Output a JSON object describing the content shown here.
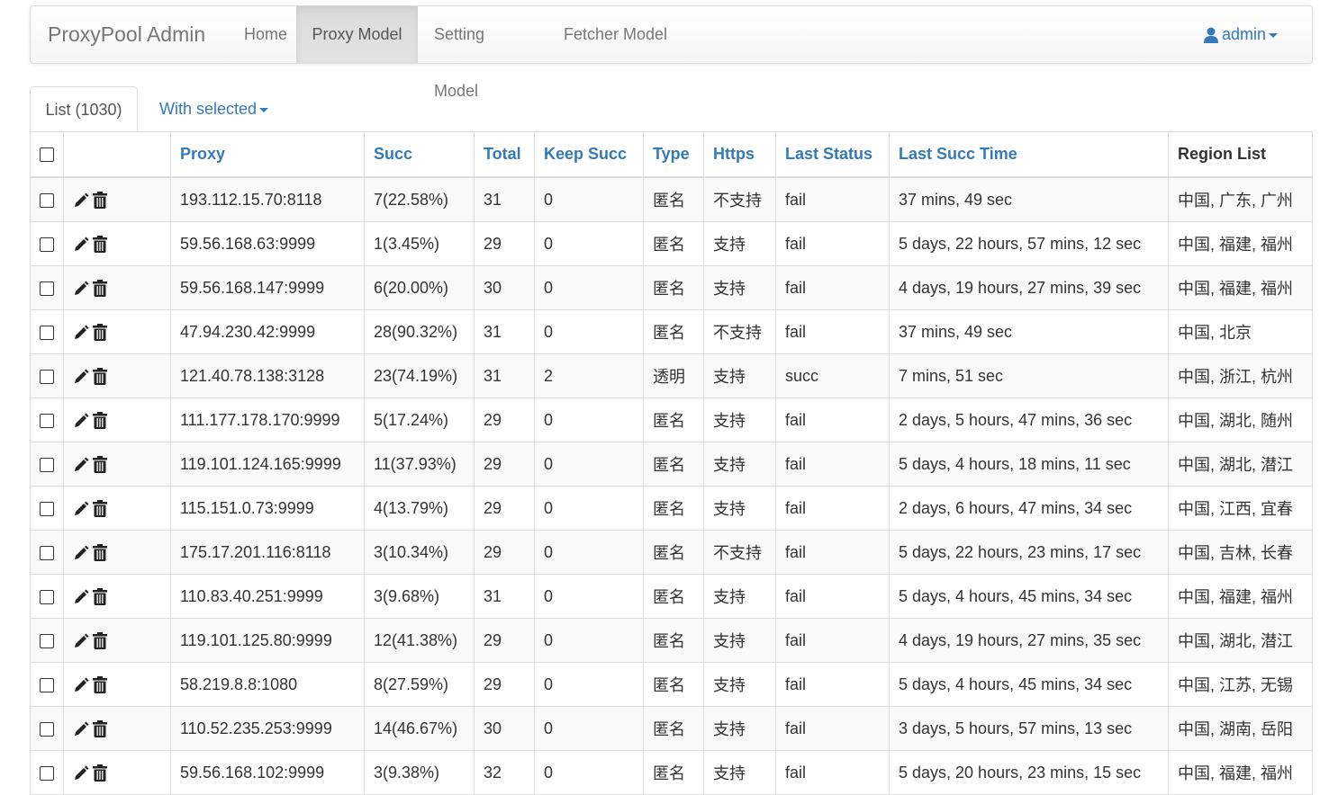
{
  "navbar": {
    "brand": "ProxyPool Admin",
    "links": [
      "Home",
      "Proxy Model",
      "Setting Model",
      "Fetcher Model"
    ],
    "active": "Proxy Model",
    "user": "admin"
  },
  "tabs": {
    "list_label": "List (1030)",
    "with_selected_label": "With selected"
  },
  "table": {
    "headers": [
      "Proxy",
      "Succ",
      "Total",
      "Keep Succ",
      "Type",
      "Https",
      "Last Status",
      "Last Succ Time",
      "Region List"
    ],
    "rows": [
      [
        "193.112.15.70:8118",
        "7(22.58%)",
        "31",
        "0",
        "匿名",
        "不支持",
        "fail",
        "37 mins, 49 sec",
        "中国, 广东, 广州"
      ],
      [
        "59.56.168.63:9999",
        "1(3.45%)",
        "29",
        "0",
        "匿名",
        "支持",
        "fail",
        "5 days, 22 hours, 57 mins, 12 sec",
        "中国, 福建, 福州"
      ],
      [
        "59.56.168.147:9999",
        "6(20.00%)",
        "30",
        "0",
        "匿名",
        "支持",
        "fail",
        "4 days, 19 hours, 27 mins, 39 sec",
        "中国, 福建, 福州"
      ],
      [
        "47.94.230.42:9999",
        "28(90.32%)",
        "31",
        "0",
        "匿名",
        "不支持",
        "fail",
        "37 mins, 49 sec",
        "中国, 北京"
      ],
      [
        "121.40.78.138:3128",
        "23(74.19%)",
        "31",
        "2",
        "透明",
        "支持",
        "succ",
        "7 mins, 51 sec",
        "中国, 浙江, 杭州"
      ],
      [
        "111.177.178.170:9999",
        "5(17.24%)",
        "29",
        "0",
        "匿名",
        "支持",
        "fail",
        "2 days, 5 hours, 47 mins, 36 sec",
        "中国, 湖北, 随州"
      ],
      [
        "119.101.124.165:9999",
        "11(37.93%)",
        "29",
        "0",
        "匿名",
        "支持",
        "fail",
        "5 days, 4 hours, 18 mins, 11 sec",
        "中国, 湖北, 潜江"
      ],
      [
        "115.151.0.73:9999",
        "4(13.79%)",
        "29",
        "0",
        "匿名",
        "支持",
        "fail",
        "2 days, 6 hours, 47 mins, 34 sec",
        "中国, 江西, 宜春"
      ],
      [
        "175.17.201.116:8118",
        "3(10.34%)",
        "29",
        "0",
        "匿名",
        "不支持",
        "fail",
        "5 days, 22 hours, 23 mins, 17 sec",
        "中国, 吉林, 长春"
      ],
      [
        "110.83.40.251:9999",
        "3(9.68%)",
        "31",
        "0",
        "匿名",
        "支持",
        "fail",
        "5 days, 4 hours, 45 mins, 34 sec",
        "中国, 福建, 福州"
      ],
      [
        "119.101.125.80:9999",
        "12(41.38%)",
        "29",
        "0",
        "匿名",
        "支持",
        "fail",
        "4 days, 19 hours, 27 mins, 35 sec",
        "中国, 湖北, 潜江"
      ],
      [
        "58.219.8.8:1080",
        "8(27.59%)",
        "29",
        "0",
        "匿名",
        "支持",
        "fail",
        "5 days, 4 hours, 45 mins, 34 sec",
        "中国, 江苏, 无锡"
      ],
      [
        "110.52.235.253:9999",
        "14(46.67%)",
        "30",
        "0",
        "匿名",
        "支持",
        "fail",
        "3 days, 5 hours, 57 mins, 13 sec",
        "中国, 湖南, 岳阳"
      ],
      [
        "59.56.168.102:9999",
        "3(9.38%)",
        "32",
        "0",
        "匿名",
        "支持",
        "fail",
        "5 days, 20 hours, 23 mins, 15 sec",
        "中国, 福建, 福州"
      ]
    ]
  },
  "icons": {
    "user": "user-icon",
    "edit": "pencil-icon",
    "delete": "trash-icon"
  },
  "colors": {
    "link": "#337ab7",
    "muted": "#777777",
    "stripe": "#f9f9f9",
    "border": "#dddddd"
  }
}
